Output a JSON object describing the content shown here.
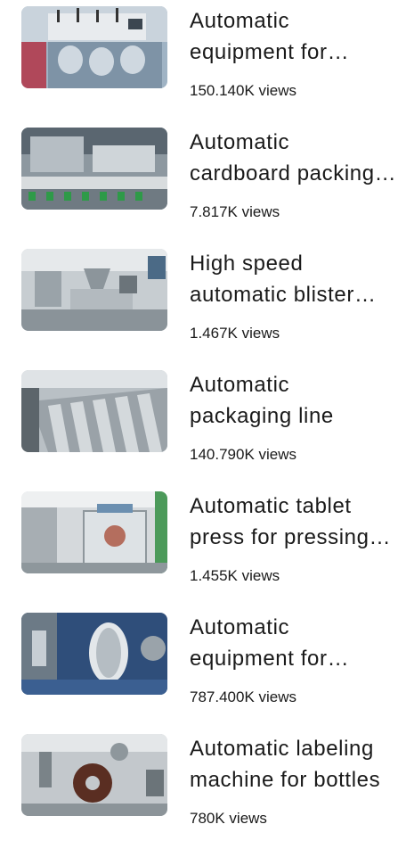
{
  "videos": [
    {
      "title": "Automatic equipment for dissolution testing",
      "views": "150.140K views"
    },
    {
      "title": "Automatic cardboard packing machine",
      "views": "7.817K views"
    },
    {
      "title": "High speed automatic blister packing machine",
      "views": "1.467K views"
    },
    {
      "title": "Automatic packaging line",
      "views": "140.790K views"
    },
    {
      "title": "Automatic tablet press for pressing tablets",
      "views": "1.455K views"
    },
    {
      "title": "Automatic equipment for capsule filling",
      "views": "787.400K views"
    },
    {
      "title": "Automatic labeling machine for bottles",
      "views": "780K views"
    }
  ]
}
